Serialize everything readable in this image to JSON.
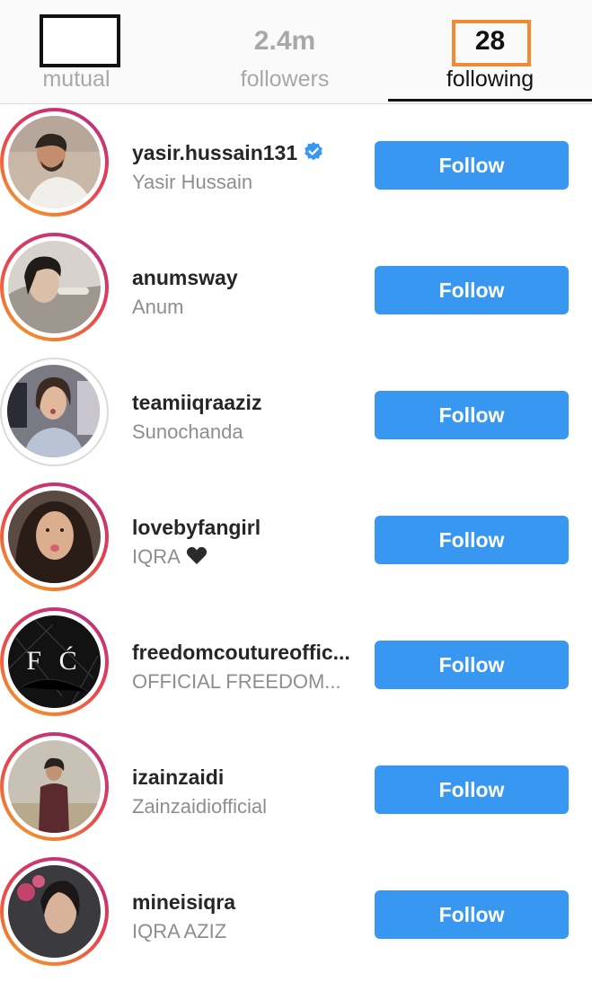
{
  "tabs": {
    "mutual": {
      "count": "",
      "label": "mutual"
    },
    "followers": {
      "count": "2.4m",
      "label": "followers"
    },
    "following": {
      "count": "28",
      "label": "following",
      "active": true
    }
  },
  "colors": {
    "follow_button": "#3897f0",
    "highlight_box": "#f28a31",
    "story_ring_start": "#f5a623",
    "story_ring_end": "#b12d8a",
    "verified_badge": "#3897f0"
  },
  "follow_label": "Follow",
  "users": [
    {
      "username": "yasir.hussain131",
      "full_name": "Yasir Hussain",
      "verified": true,
      "story_ring": true
    },
    {
      "username": "anumsway",
      "full_name": "Anum",
      "verified": false,
      "story_ring": true
    },
    {
      "username": "teamiiqraaziz",
      "full_name": "Sunochanda",
      "verified": false,
      "story_ring": false
    },
    {
      "username": "lovebyfangirl",
      "full_name": "IQRA",
      "name_emoji": "black-heart-icon",
      "verified": false,
      "story_ring": true
    },
    {
      "username": "freedomcoutureoffic...",
      "full_name": "OFFICIAL FREEDOM...",
      "avatar_text": "F Ć",
      "verified": false,
      "story_ring": true
    },
    {
      "username": "izainzaidi",
      "full_name": "Zainzaidiofficial",
      "verified": false,
      "story_ring": true
    },
    {
      "username": "mineisiqra",
      "full_name": "IQRA AZIZ",
      "verified": false,
      "story_ring": true
    }
  ]
}
